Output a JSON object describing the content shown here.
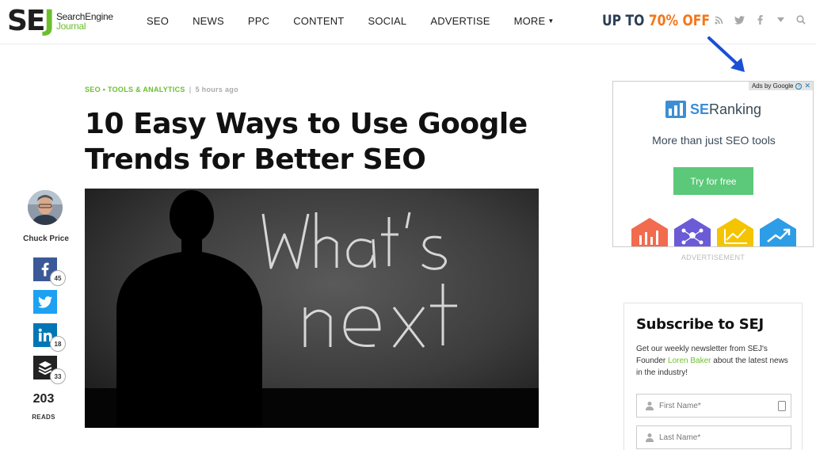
{
  "header": {
    "logo_mark": "SEJ",
    "logo_line1": "SearchEngine",
    "logo_line2": "Journal",
    "nav": [
      "SEO",
      "NEWS",
      "PPC",
      "CONTENT",
      "SOCIAL",
      "ADVERTISE",
      "MORE"
    ],
    "promo_prefix": "UP TO ",
    "promo_highlight": "70% OFF",
    "icons": [
      "rss-icon",
      "twitter-icon",
      "facebook-icon",
      "dropdown-icon",
      "search-icon"
    ]
  },
  "article": {
    "category": "SEO • TOOLS & ANALYTICS",
    "separator": "|",
    "time": "5 hours ago",
    "title": "10 Easy Ways to Use Google Trends for Better SEO",
    "hero_text_top": "What's",
    "hero_text_bottom": "next"
  },
  "author": {
    "name": "Chuck Price"
  },
  "share": {
    "facebook_count": "45",
    "linkedin_count": "18",
    "buffer_count": "33",
    "reads": "203",
    "reads_label": "READS"
  },
  "ad": {
    "ads_by": "Ads by Google",
    "brand_se": "SE",
    "brand_rest": "Ranking",
    "tagline": "More than just SEO tools",
    "cta": "Try for free",
    "label": "ADVERTISEMENT",
    "icon_colors": [
      "#f26b4e",
      "#6b5bd6",
      "#f5c400",
      "#2c9de6"
    ]
  },
  "subscribe": {
    "title": "Subscribe to SEJ",
    "desc_before": "Get our weekly newsletter from SEJ's Founder ",
    "desc_link": "Loren Baker",
    "desc_after": " about the latest news in the industry!",
    "first_name_placeholder": "First Name*",
    "last_name_placeholder": "Last Name*"
  },
  "colors": {
    "brand_green": "#6bbf2d",
    "promo_orange": "#f5761a",
    "annotation_blue": "#1a4fd6"
  }
}
